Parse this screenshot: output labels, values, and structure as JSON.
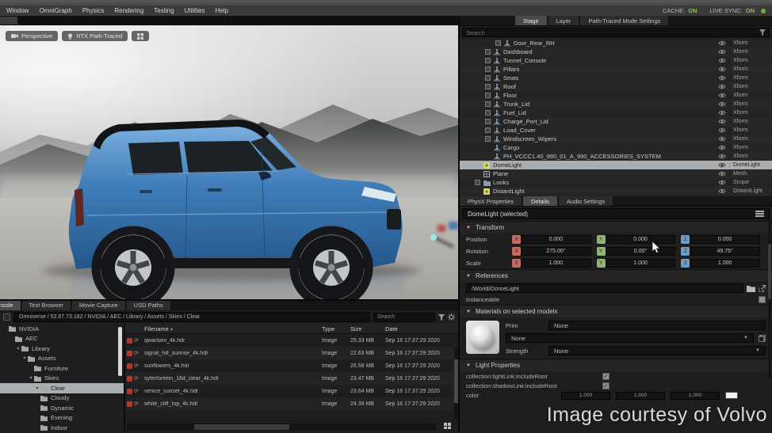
{
  "menu": {
    "items": [
      "Window",
      "OmniGraph",
      "Physics",
      "Rendering",
      "Testing",
      "Utilities",
      "Help"
    ]
  },
  "status": {
    "cache_label": "CACHE:",
    "cache_value": "ON",
    "sync_label": "LIVE SYNC:",
    "sync_value": "ON",
    "on_color": "#8fc140"
  },
  "viewport": {
    "camera_button": "Perspective",
    "render_mode_button": "RTX Path-Traced",
    "scene_description": "Blue Volvo XC40 SUV, side view, studio floor with foggy mountain backdrop"
  },
  "stage": {
    "tabs": [
      "Stage",
      "Layer",
      "Path-Traced Mode Settings"
    ],
    "active_tab": "Stage",
    "search_placeholder": "Search",
    "rows": [
      {
        "name": "Door_Rear_RH",
        "type": "Xform",
        "depth": 3,
        "expand": true,
        "icon": "xform"
      },
      {
        "name": "Dashboard",
        "type": "Xform",
        "depth": 2,
        "expand": true,
        "icon": "xform"
      },
      {
        "name": "Tunnel_Console",
        "type": "Xform",
        "depth": 2,
        "expand": true,
        "icon": "xform"
      },
      {
        "name": "Pillars",
        "type": "Xform",
        "depth": 2,
        "expand": true,
        "icon": "xform"
      },
      {
        "name": "Seats",
        "type": "Xform",
        "depth": 2,
        "expand": true,
        "icon": "xform"
      },
      {
        "name": "Roof",
        "type": "Xform",
        "depth": 2,
        "expand": true,
        "icon": "xform"
      },
      {
        "name": "Floor",
        "type": "Xform",
        "depth": 2,
        "expand": true,
        "icon": "xform"
      },
      {
        "name": "Trunk_Lid",
        "type": "Xform",
        "depth": 2,
        "expand": true,
        "icon": "xform"
      },
      {
        "name": "Fuel_Lid",
        "type": "Xform",
        "depth": 2,
        "expand": true,
        "icon": "xform"
      },
      {
        "name": "Charge_Port_Lid",
        "type": "Xform",
        "depth": 2,
        "expand": true,
        "icon": "xform"
      },
      {
        "name": "Load_Cover",
        "type": "Xform",
        "depth": 2,
        "expand": true,
        "icon": "xform"
      },
      {
        "name": "Windscreen_Wipers",
        "type": "Xform",
        "depth": 2,
        "expand": true,
        "icon": "xform"
      },
      {
        "name": "Cargo",
        "type": "Xform",
        "depth": 2,
        "expand": false,
        "icon": "xform"
      },
      {
        "name": "PH_VCCC1.40_990_01_A_990_ACCESSORIES_SYSTEM",
        "type": "Xform",
        "depth": 2,
        "expand": false,
        "icon": "xform"
      },
      {
        "name": "DomeLight",
        "type": "DomeLight",
        "depth": 1,
        "expand": false,
        "icon": "light",
        "selected": true
      },
      {
        "name": "Plane",
        "type": "Mesh",
        "depth": 1,
        "expand": false,
        "icon": "mesh"
      },
      {
        "name": "Looks",
        "type": "Scope",
        "depth": 1,
        "expand": true,
        "icon": "scope"
      },
      {
        "name": "DistantLight",
        "type": "DistantLight",
        "depth": 1,
        "expand": false,
        "icon": "light"
      }
    ]
  },
  "properties": {
    "tabs": [
      "PhysX Properties",
      "Details",
      "Audio Settings"
    ],
    "active_tab": "Details",
    "header": "DomeLight (selected)",
    "transform": {
      "section_label": "Transform",
      "axis_labels": [
        "X",
        "Y",
        "Z"
      ],
      "axis_colors": {
        "x": "#c96a62",
        "y": "#8fb671",
        "z": "#6d9ec6"
      },
      "rows": [
        {
          "label": "Position",
          "x": "0.000",
          "y": "0.000",
          "z": "0.000"
        },
        {
          "label": "Rotation",
          "x": "275.00°",
          "y": "0.00°",
          "z": "49.75°"
        },
        {
          "label": "Scale",
          "x": "1.000",
          "y": "1.000",
          "z": "1.000"
        }
      ]
    },
    "references": {
      "section_label": "References",
      "path": "/World/DomeLight",
      "instanceable_label": "instanceable"
    },
    "materials": {
      "section_label": "Materials on selected models",
      "prim_label": "Prim",
      "prim_value": "None",
      "material_value": "None",
      "strength_label": "Strength",
      "strength_value": "None"
    },
    "light": {
      "section_label": "Light Properties",
      "rows": [
        "collection:lightLink:includeRoot",
        "collection:shadowLink:includeRoot"
      ],
      "color_label": "color",
      "color_values": [
        "1.000",
        "1.000",
        "1.000"
      ]
    }
  },
  "browser": {
    "tabs": [
      "Console",
      "Text Browser",
      "Movie Capture",
      "USD Paths"
    ],
    "active_tab": "Console",
    "path": "Omniverse / 52.67.73.182 / NVIDIA / AEC / Library / Assets / Skies / Clear",
    "search_placeholder": "Search",
    "columns": [
      "Filename",
      "Type",
      "Size",
      "Date"
    ],
    "tree": [
      {
        "label": "NVIDIA",
        "depth": 0,
        "arrow": false
      },
      {
        "label": "AEC",
        "depth": 1,
        "arrow": false
      },
      {
        "label": "Library",
        "depth": 2,
        "arrow": true
      },
      {
        "label": "Assets",
        "depth": 3,
        "arrow": true
      },
      {
        "label": "Furniture",
        "depth": 4,
        "arrow": false
      },
      {
        "label": "Skies",
        "depth": 4,
        "arrow": true
      },
      {
        "label": "Clear",
        "depth": 5,
        "arrow": true,
        "selected": true
      },
      {
        "label": "Cloudy",
        "depth": 5,
        "arrow": false
      },
      {
        "label": "Dynamic",
        "depth": 5,
        "arrow": false
      },
      {
        "label": "Evening",
        "depth": 5,
        "arrow": false
      },
      {
        "label": "Indoor",
        "depth": 5,
        "arrow": false
      }
    ],
    "files": [
      {
        "name": "qwantani_4k.hdr",
        "type": "Image",
        "size": "25.33 MB",
        "date": "Sep 16 17:37:29 2020"
      },
      {
        "name": "signal_hill_sunrise_4k.hdr",
        "type": "Image",
        "size": "22.63 MB",
        "date": "Sep 16 17:37:29 2020"
      },
      {
        "name": "sunflowers_4k.hdr",
        "type": "Image",
        "size": "26.58 MB",
        "date": "Sep 16 17:37:29 2020"
      },
      {
        "name": "syferfontein_18d_clear_4k.hdr",
        "type": "Image",
        "size": "23.47 MB",
        "date": "Sep 16 17:37:29 2020"
      },
      {
        "name": "venice_sunset_4k.hdr",
        "type": "Image",
        "size": "23.64 MB",
        "date": "Sep 16 17:37:29 2020"
      },
      {
        "name": "white_cliff_top_4k.hdr",
        "type": "Image",
        "size": "24.39 MB",
        "date": "Sep 16 17:37:29 2020"
      }
    ]
  },
  "watermark": "Image courtesy of Volvo"
}
